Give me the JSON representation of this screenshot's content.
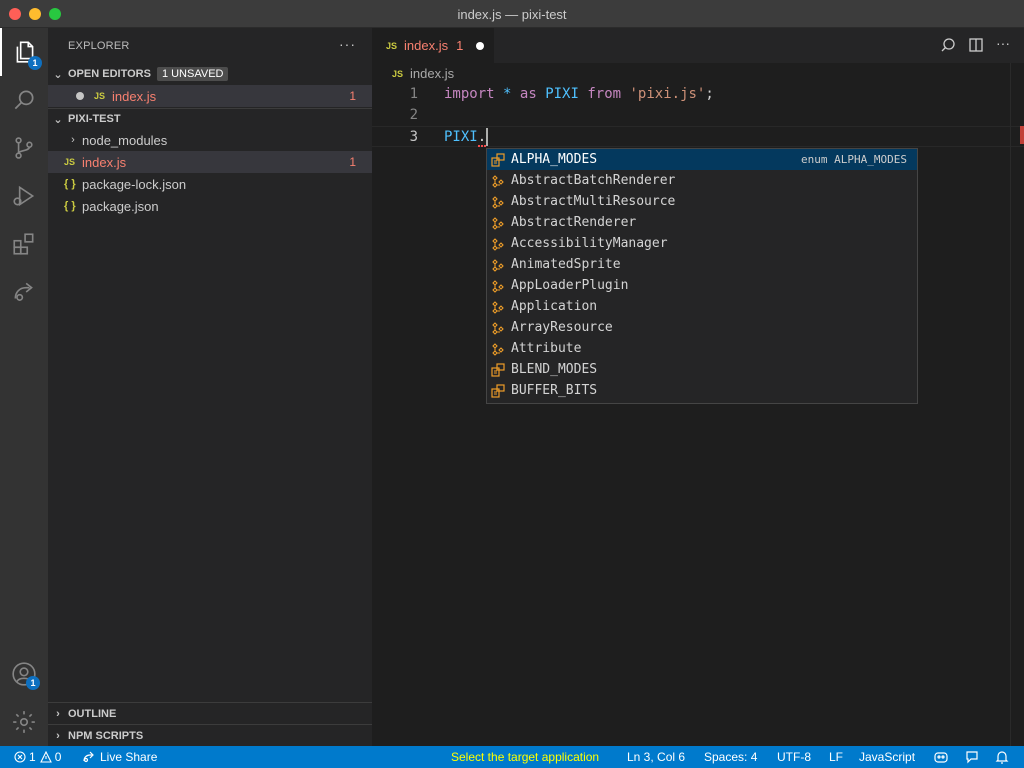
{
  "window": {
    "title": "index.js — pixi-test"
  },
  "activity_bar": {
    "explorer_badge": "1",
    "accounts_badge": "1"
  },
  "sidebar": {
    "title": "EXPLORER",
    "more_label": "···",
    "open_editors": {
      "label": "OPEN EDITORS",
      "badge": "1 UNSAVED",
      "files": [
        {
          "icon": "JS",
          "name": "index.js",
          "problems": "1"
        }
      ]
    },
    "project": {
      "label": "PIXI-TEST",
      "items": [
        {
          "type": "folder",
          "name": "node_modules"
        },
        {
          "type": "js",
          "icon": "JS",
          "name": "index.js",
          "problems": "1"
        },
        {
          "type": "json",
          "icon": "{ }",
          "name": "package-lock.json"
        },
        {
          "type": "json",
          "icon": "{ }",
          "name": "package.json"
        }
      ]
    },
    "outline_label": "OUTLINE",
    "npm_scripts_label": "NPM SCRIPTS"
  },
  "editor": {
    "tab": {
      "icon": "JS",
      "name": "index.js",
      "problems": "1"
    },
    "breadcrumb": {
      "icon": "JS",
      "file": "index.js"
    },
    "lines": [
      {
        "num": "1",
        "tokens": [
          {
            "t": "import",
            "c": "kw"
          },
          {
            "t": " ",
            "c": "op"
          },
          {
            "t": "*",
            "c": "var"
          },
          {
            "t": " ",
            "c": "op"
          },
          {
            "t": "as",
            "c": "kw"
          },
          {
            "t": " ",
            "c": "op"
          },
          {
            "t": "PIXI",
            "c": "var"
          },
          {
            "t": " ",
            "c": "op"
          },
          {
            "t": "from",
            "c": "kw"
          },
          {
            "t": " ",
            "c": "op"
          },
          {
            "t": "'pixi.js'",
            "c": "str"
          },
          {
            "t": ";",
            "c": "pun"
          }
        ]
      },
      {
        "num": "2",
        "tokens": []
      },
      {
        "num": "3",
        "tokens": [
          {
            "t": "PIXI",
            "c": "var"
          },
          {
            "t": ".",
            "c": "pun"
          }
        ]
      }
    ],
    "suggestions": [
      {
        "label": "ALPHA_MODES",
        "kind": "enum",
        "detail": "enum ALPHA_MODES"
      },
      {
        "label": "AbstractBatchRenderer",
        "kind": "class"
      },
      {
        "label": "AbstractMultiResource",
        "kind": "class"
      },
      {
        "label": "AbstractRenderer",
        "kind": "class"
      },
      {
        "label": "AccessibilityManager",
        "kind": "class"
      },
      {
        "label": "AnimatedSprite",
        "kind": "class"
      },
      {
        "label": "AppLoaderPlugin",
        "kind": "class"
      },
      {
        "label": "Application",
        "kind": "class"
      },
      {
        "label": "ArrayResource",
        "kind": "class"
      },
      {
        "label": "Attribute",
        "kind": "class"
      },
      {
        "label": "BLEND_MODES",
        "kind": "enum"
      },
      {
        "label": "BUFFER_BITS",
        "kind": "enum"
      }
    ]
  },
  "status_bar": {
    "errors": "1",
    "warnings": "0",
    "live_share": "Live Share",
    "message": "Select the target application",
    "position": "Ln 3, Col 6",
    "spaces": "Spaces: 4",
    "encoding": "UTF-8",
    "eol": "LF",
    "language": "JavaScript"
  },
  "colors": {
    "accent": "#007acc",
    "error": "#f88070",
    "status_message": "#ffff00",
    "enum_icon": "#ee9d28",
    "class_icon": "#ee9d28"
  }
}
